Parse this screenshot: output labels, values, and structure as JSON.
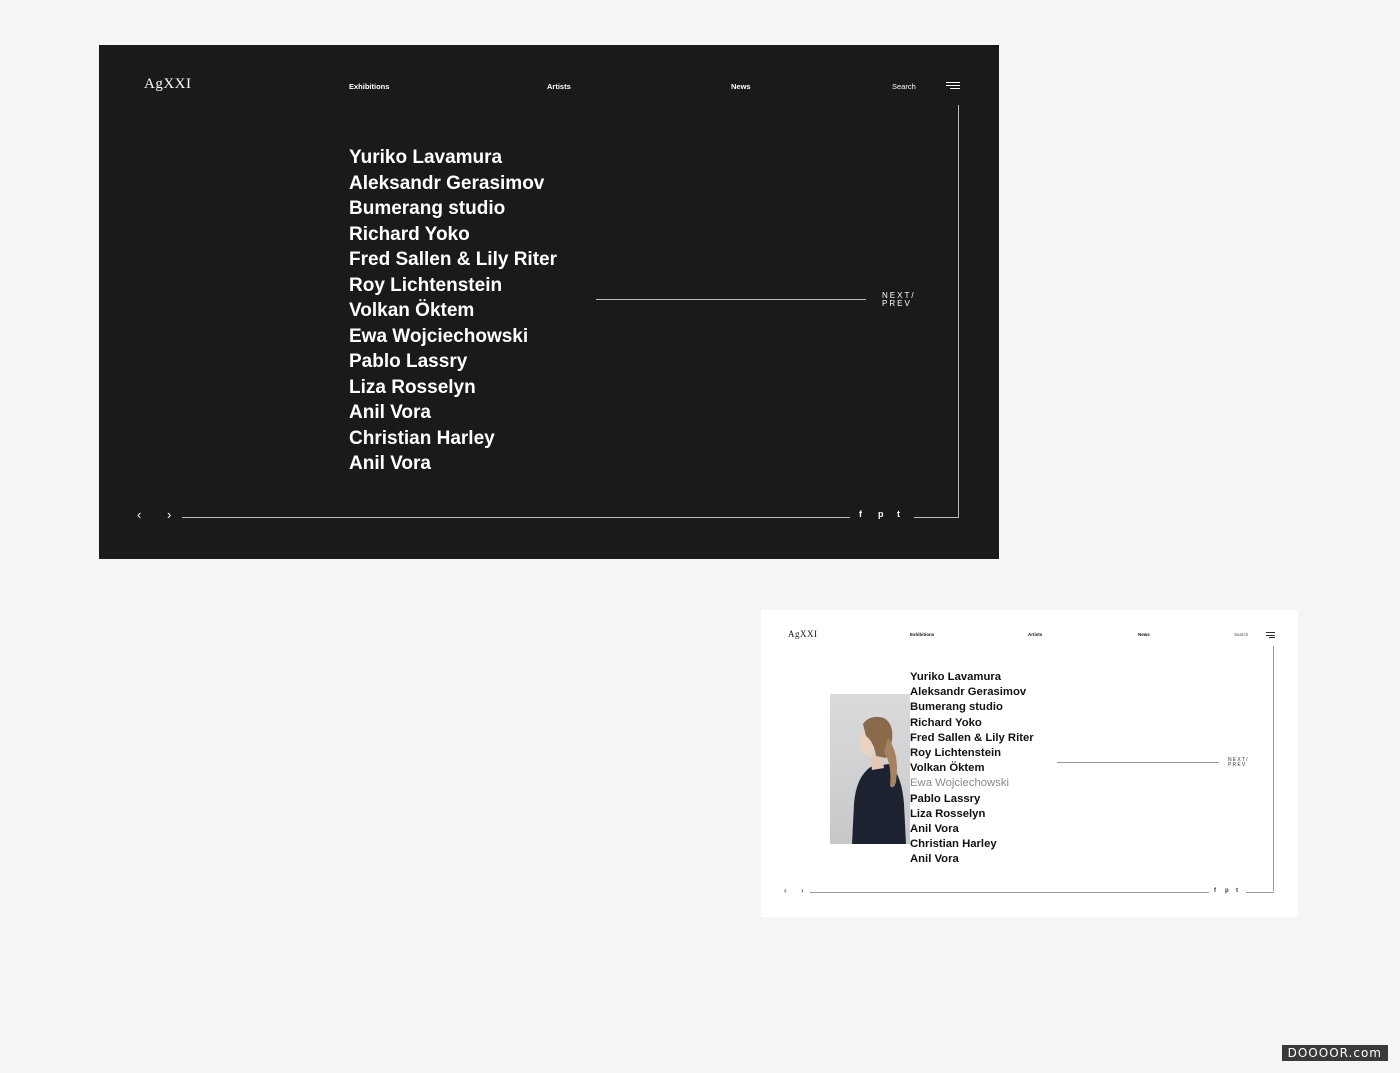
{
  "dark_screen": {
    "logo": "AgXXI",
    "nav": [
      "Exhibitions",
      "Artists",
      "News"
    ],
    "search_label": "Search",
    "artists": [
      "Yuriko Lavamura",
      "Aleksandr Gerasimov",
      "Bumerang studio",
      "Richard Yoko",
      "Fred Sallen & Lily Riter",
      "Roy Lichtenstein",
      "Volkan Öktem",
      "Ewa Wojciechowski",
      "Pablo Lassry",
      "Liza Rosselyn",
      "Anil Vora",
      "Christian Harley",
      "Anil Vora"
    ],
    "next_prev": [
      "NEXT/",
      "PREV"
    ],
    "prev_arrow": "‹",
    "next_arrow": "›",
    "social": [
      "f",
      "p",
      "t"
    ],
    "background": "#1a1a1a"
  },
  "light_screen": {
    "logo": "AgXXI",
    "nav": [
      "Exhibitions",
      "Artists",
      "News"
    ],
    "search_label": "Search",
    "artists": [
      "Yuriko Lavamura",
      "Aleksandr Gerasimov",
      "Bumerang studio",
      "Richard Yoko",
      "Fred Sallen & Lily Riter",
      "Roy Lichtenstein",
      "Volkan Öktem",
      "Ewa Wojciechowski",
      "Pablo Lassry",
      "Liza Rosselyn",
      "Anil Vora",
      "Christian Harley",
      "Anil Vora"
    ],
    "hovered_artist": "Ewa Wojciechowski",
    "next_prev": [
      "NEXT/",
      "PREV"
    ],
    "prev_arrow": "‹",
    "next_arrow": "›",
    "social": [
      "f",
      "p",
      "t"
    ],
    "background": "#ffffff"
  },
  "watermark": "DOOOOR.com",
  "page_background": "#f5f5f5"
}
